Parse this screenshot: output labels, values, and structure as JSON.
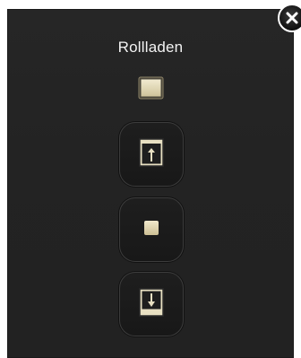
{
  "dialog": {
    "title": "Rollladen",
    "close_icon": "close-icon",
    "status_icon": "blind-status-icon",
    "buttons": [
      {
        "name": "up",
        "icon": "blind-up-icon"
      },
      {
        "name": "stop",
        "icon": "stop-icon"
      },
      {
        "name": "down",
        "icon": "blind-down-icon"
      }
    ]
  },
  "colors": {
    "panel_background": "#242424",
    "icon_fill": "#e8e0c2",
    "icon_border": "#c9bd94",
    "title_text": "#f2f2f2"
  }
}
